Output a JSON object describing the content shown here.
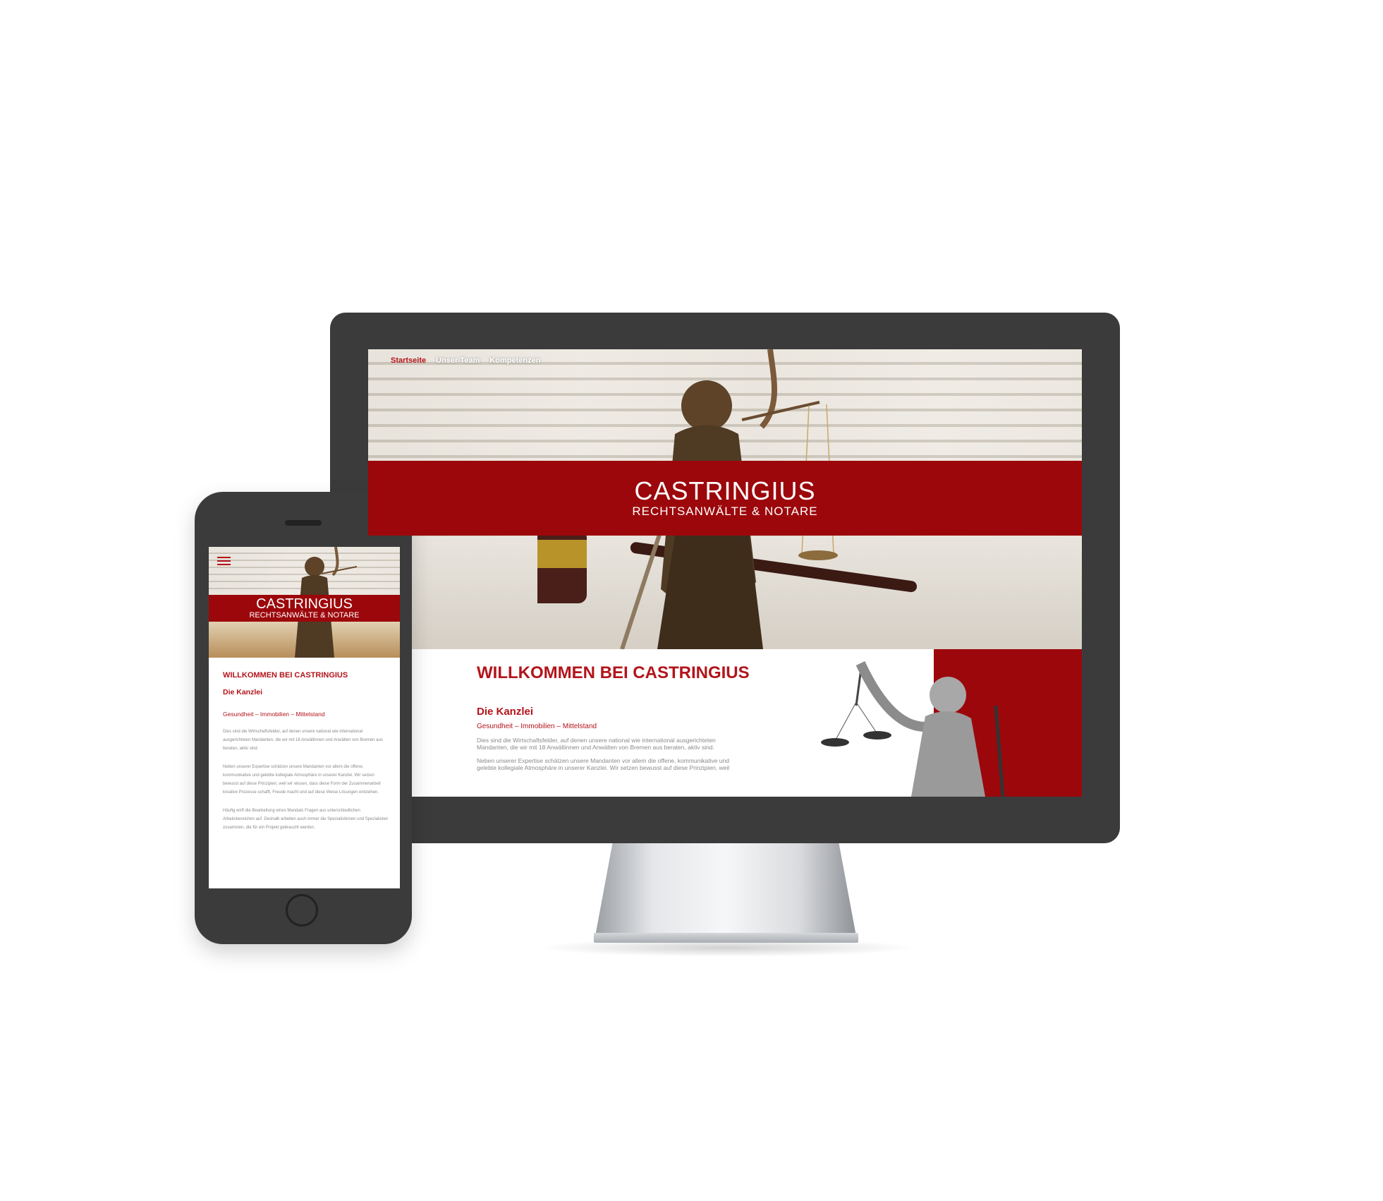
{
  "desktop": {
    "nav": [
      {
        "label": "Startseite",
        "active": true
      },
      {
        "label": "Unser Team",
        "active": false
      },
      {
        "label": "Kompetenzen",
        "active": false
      }
    ],
    "brand": {
      "name": "CASTRINGIUS",
      "tagline": "RECHTSANWÄLTE & NOTARE"
    },
    "welcome_title": "WILLKOMMEN BEI CASTRINGIUS",
    "section_title": "Die Kanzlei",
    "section_subtitle": "Gesundheit – Immobilien – Mittelstand",
    "paragraphs": [
      "Dies sind die Wirtschaftsfelder, auf denen unsere national wie international ausgerichteten Mandanten, die wir mit 18 Anwältinnen und Anwälten von Bremen aus beraten, aktiv sind.",
      "Neben unserer Expertise schätzen unsere Mandanten vor allem die offene, kommunikative und gelebte kollegiale Atmosphäre in unserer Kanzlei. Wir setzen bewusst auf diese Prinzipien, weil"
    ]
  },
  "mobile": {
    "brand": {
      "name": "CASTRINGIUS",
      "tagline": "RECHTSANWÄLTE & NOTARE"
    },
    "welcome_title": "WILLKOMMEN BEI CASTRINGIUS",
    "section_title": "Die Kanzlei",
    "section_subtitle": "Gesundheit – Immobilien – Mittelstand",
    "paragraphs": [
      "Dies sind die Wirtschaftsfelder, auf denen unsere national wie international ausgerichteten Mandanten, die wir mit 18 Anwältinnen und Anwälten von Bremen aus beraten, aktiv sind.",
      "Neben unserer Expertise schätzen unsere Mandanten vor allem die offene, kommunikative und gelebte kollegiale Atmosphäre in unserer Kanzlei. Wir setzen bewusst auf diese Prinzipien, weil wir wissen, dass diese Form der Zusammenarbeit kreative Prozesse schafft, Freude macht und auf diese Weise Lösungen entstehen.",
      "Häufig wirft die Bearbeitung eines Mandats Fragen aus unterschiedlichen Arbeitsbereichen auf. Deshalb arbeiten auch immer die Spezialistinnen und Spezialisten zusammen, die für ein Projekt gebraucht werden."
    ]
  },
  "colors": {
    "brand_red": "#9c070b",
    "text_red": "#b3141b",
    "device_frame": "#3b3b3b"
  }
}
